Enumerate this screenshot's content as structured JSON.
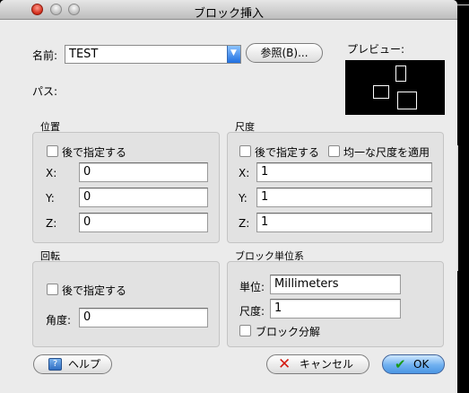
{
  "window": {
    "title": "ブロック挿入"
  },
  "name": {
    "label": "名前:",
    "value": "TEST",
    "browse_label": "参照(B)..."
  },
  "path": {
    "label": "パス:"
  },
  "preview": {
    "label": "プレビュー:"
  },
  "position": {
    "title": "位置",
    "specify_later": "後で指定する",
    "x_label": "X:",
    "x_value": "0",
    "y_label": "Y:",
    "y_value": "0",
    "z_label": "Z:",
    "z_value": "0"
  },
  "scale": {
    "title": "尺度",
    "specify_later": "後で指定する",
    "uniform": "均一な尺度を適用",
    "x_label": "X:",
    "x_value": "1",
    "y_label": "Y:",
    "y_value": "1",
    "z_label": "Z:",
    "z_value": "1"
  },
  "rotation": {
    "title": "回転",
    "specify_later": "後で指定する",
    "angle_label": "角度:",
    "angle_value": "0"
  },
  "block_unit": {
    "title": "ブロック単位系",
    "unit_label": "単位:",
    "unit_value": "Millimeters",
    "factor_label": "尺度:",
    "factor_value": "1",
    "explode": "ブロック分解"
  },
  "buttons": {
    "help": "ヘルプ",
    "cancel": "キャンセル",
    "ok": "OK"
  }
}
